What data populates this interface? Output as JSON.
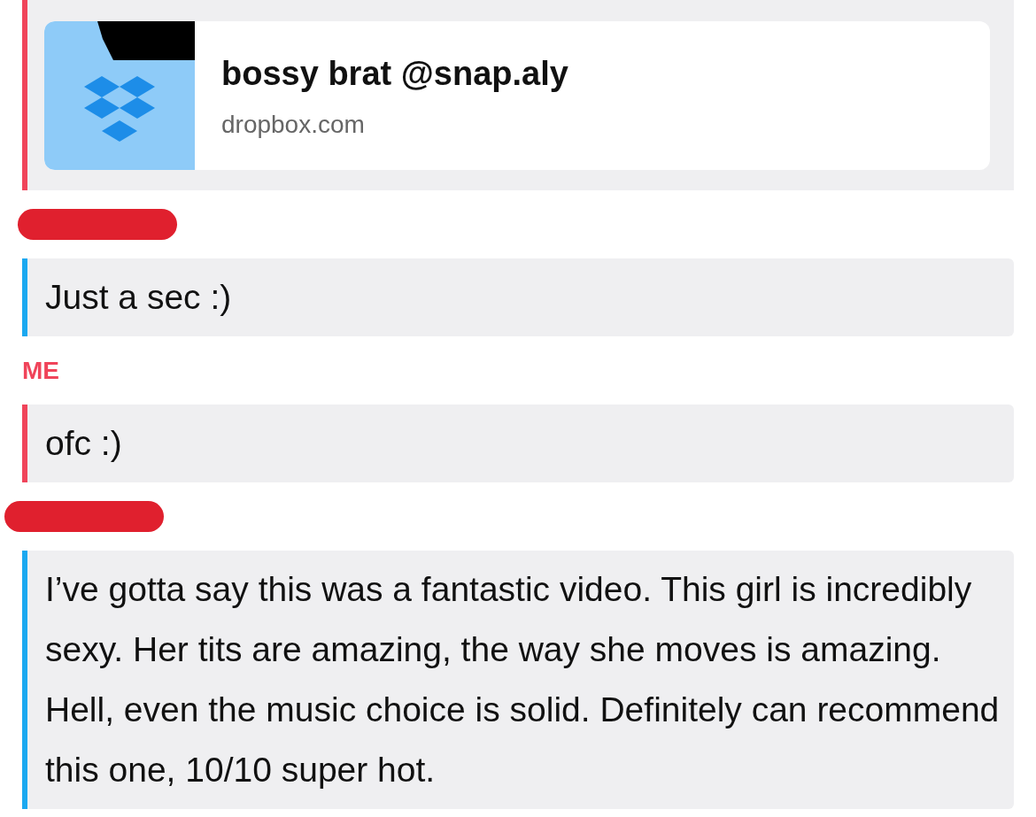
{
  "items": [
    {
      "kind": "link",
      "from_me": true,
      "title": "bossy brat @snap.aly",
      "domain": "dropbox.com"
    },
    {
      "kind": "redacted"
    },
    {
      "kind": "message",
      "from_me": false,
      "text": "Just a sec :)"
    },
    {
      "kind": "sender",
      "from_me": true,
      "label": "ME"
    },
    {
      "kind": "message",
      "from_me": true,
      "text": "ofc :)"
    },
    {
      "kind": "redacted"
    },
    {
      "kind": "message",
      "from_me": false,
      "text": "I’ve gotta say this was a fantastic video. This girl is incredibly sexy. Her tits are amazing, the way she moves is amazing. Hell, even the music choice is solid. Definitely can recommend this one, 10/10 super hot."
    }
  ]
}
